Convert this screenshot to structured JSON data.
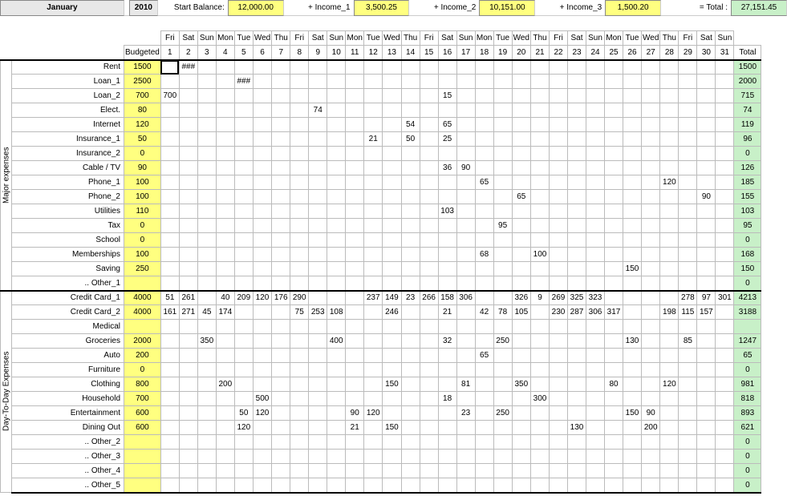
{
  "header": {
    "month": "January",
    "year": "2010",
    "start_balance_label": "Start Balance:",
    "start_balance": "12,000.00",
    "income1_label": "+ Income_1",
    "income1": "3,500.25",
    "income2_label": "+ Income_2",
    "income2": "10,151.00",
    "income3_label": "+ Income_3",
    "income3": "1,500.20",
    "total_label": "= Total :",
    "total": "27,151.45"
  },
  "columns": {
    "budgeted": "Budgeted",
    "total": "Total",
    "dow": [
      "Fri",
      "Sat",
      "Sun",
      "Mon",
      "Tue",
      "Wed",
      "Thu",
      "Fri",
      "Sat",
      "Sun",
      "Mon",
      "Tue",
      "Wed",
      "Thu",
      "Fri",
      "Sat",
      "Sun",
      "Mon",
      "Tue",
      "Wed",
      "Thu",
      "Fri",
      "Sat",
      "Sun",
      "Mon",
      "Tue",
      "Wed",
      "Thu",
      "Fri",
      "Sat",
      "Sun"
    ],
    "days": [
      "1",
      "2",
      "3",
      "4",
      "5",
      "6",
      "7",
      "8",
      "9",
      "10",
      "11",
      "12",
      "13",
      "14",
      "15",
      "16",
      "17",
      "18",
      "19",
      "20",
      "21",
      "22",
      "23",
      "24",
      "25",
      "26",
      "27",
      "28",
      "29",
      "30",
      "31"
    ]
  },
  "sections": [
    {
      "name": "Major expenses",
      "rows": [
        {
          "label": "Rent",
          "budgeted": "1500",
          "cells": {
            "2": "###"
          },
          "total": "1500"
        },
        {
          "label": "Loan_1",
          "budgeted": "2500",
          "cells": {
            "5": "###"
          },
          "total": "2000"
        },
        {
          "label": "Loan_2",
          "budgeted": "700",
          "cells": {
            "1": "700",
            "16": "15"
          },
          "total": "715"
        },
        {
          "label": "Elect.",
          "budgeted": "80",
          "cells": {
            "9": "74"
          },
          "total": "74"
        },
        {
          "label": "Internet",
          "budgeted": "120",
          "cells": {
            "14": "54",
            "16": "65"
          },
          "total": "119"
        },
        {
          "label": "Insurance_1",
          "budgeted": "50",
          "cells": {
            "12": "21",
            "14": "50",
            "16": "25"
          },
          "total": "96"
        },
        {
          "label": "Insurance_2",
          "budgeted": "0",
          "cells": {},
          "total": "0"
        },
        {
          "label": "Cable / TV",
          "budgeted": "90",
          "cells": {
            "16": "36",
            "17": "90"
          },
          "total": "126"
        },
        {
          "label": "Phone_1",
          "budgeted": "100",
          "cells": {
            "18": "65",
            "28": "120"
          },
          "total": "185"
        },
        {
          "label": "Phone_2",
          "budgeted": "100",
          "cells": {
            "20": "65",
            "30": "90"
          },
          "total": "155"
        },
        {
          "label": "Utilities",
          "budgeted": "110",
          "cells": {
            "16": "103"
          },
          "total": "103"
        },
        {
          "label": "Tax",
          "budgeted": "0",
          "cells": {
            "19": "95"
          },
          "total": "95"
        },
        {
          "label": "School",
          "budgeted": "0",
          "cells": {},
          "total": "0"
        },
        {
          "label": "Memberships",
          "budgeted": "100",
          "cells": {
            "18": "68",
            "21": "100"
          },
          "total": "168"
        },
        {
          "label": "Saving",
          "budgeted": "250",
          "cells": {
            "26": "150"
          },
          "total": "150"
        },
        {
          "label": ".. Other_1",
          "budgeted": "",
          "cells": {},
          "total": "0"
        }
      ]
    },
    {
      "name": "Day-To-Day Expenses",
      "rows": [
        {
          "label": "Credit Card_1",
          "budgeted": "4000",
          "cells": {
            "1": "51",
            "2": "261",
            "4": "40",
            "5": "209",
            "6": "120",
            "7": "176",
            "8": "290",
            "12": "237",
            "13": "149",
            "14": "23",
            "15": "266",
            "16": "158",
            "17": "306",
            "20": "326",
            "21": "9",
            "22": "269",
            "23": "325",
            "24": "323",
            "29": "278",
            "30": "97",
            "31": "301"
          },
          "total": "4213"
        },
        {
          "label": "Credit Card_2",
          "budgeted": "4000",
          "cells": {
            "1": "161",
            "2": "271",
            "3": "45",
            "4": "174",
            "8": "75",
            "9": "253",
            "10": "108",
            "13": "246",
            "16": "21",
            "18": "42",
            "19": "78",
            "20": "105",
            "22": "230",
            "23": "287",
            "24": "306",
            "25": "317",
            "28": "198",
            "29": "115",
            "30": "157"
          },
          "total": "3188"
        },
        {
          "label": "Medical",
          "budgeted": "",
          "cells": {},
          "total": ""
        },
        {
          "label": "Groceries",
          "budgeted": "2000",
          "cells": {
            "3": "350",
            "10": "400",
            "16": "32",
            "19": "250",
            "26": "130",
            "29": "85"
          },
          "total": "1247"
        },
        {
          "label": "Auto",
          "budgeted": "200",
          "cells": {
            "18": "65"
          },
          "total": "65"
        },
        {
          "label": "Furniture",
          "budgeted": "0",
          "cells": {},
          "total": "0"
        },
        {
          "label": "Clothing",
          "budgeted": "800",
          "cells": {
            "4": "200",
            "13": "150",
            "17": "81",
            "20": "350",
            "25": "80",
            "28": "120"
          },
          "total": "981"
        },
        {
          "label": "Household",
          "budgeted": "700",
          "cells": {
            "6": "500",
            "16": "18",
            "21": "300"
          },
          "total": "818"
        },
        {
          "label": "Entertainment",
          "budgeted": "600",
          "cells": {
            "5": "50",
            "6": "120",
            "11": "90",
            "12": "120",
            "17": "23",
            "19": "250",
            "26": "150",
            "27": "90"
          },
          "total": "893"
        },
        {
          "label": "Dining Out",
          "budgeted": "600",
          "cells": {
            "5": "120",
            "11": "21",
            "13": "150",
            "23": "130",
            "27": "200"
          },
          "total": "621"
        },
        {
          "label": ".. Other_2",
          "budgeted": "",
          "cells": {},
          "total": "0"
        },
        {
          "label": ".. Other_3",
          "budgeted": "",
          "cells": {},
          "total": "0"
        },
        {
          "label": ".. Other_4",
          "budgeted": "",
          "cells": {},
          "total": "0"
        },
        {
          "label": ".. Other_5",
          "budgeted": "",
          "cells": {},
          "total": "0"
        }
      ]
    }
  ]
}
